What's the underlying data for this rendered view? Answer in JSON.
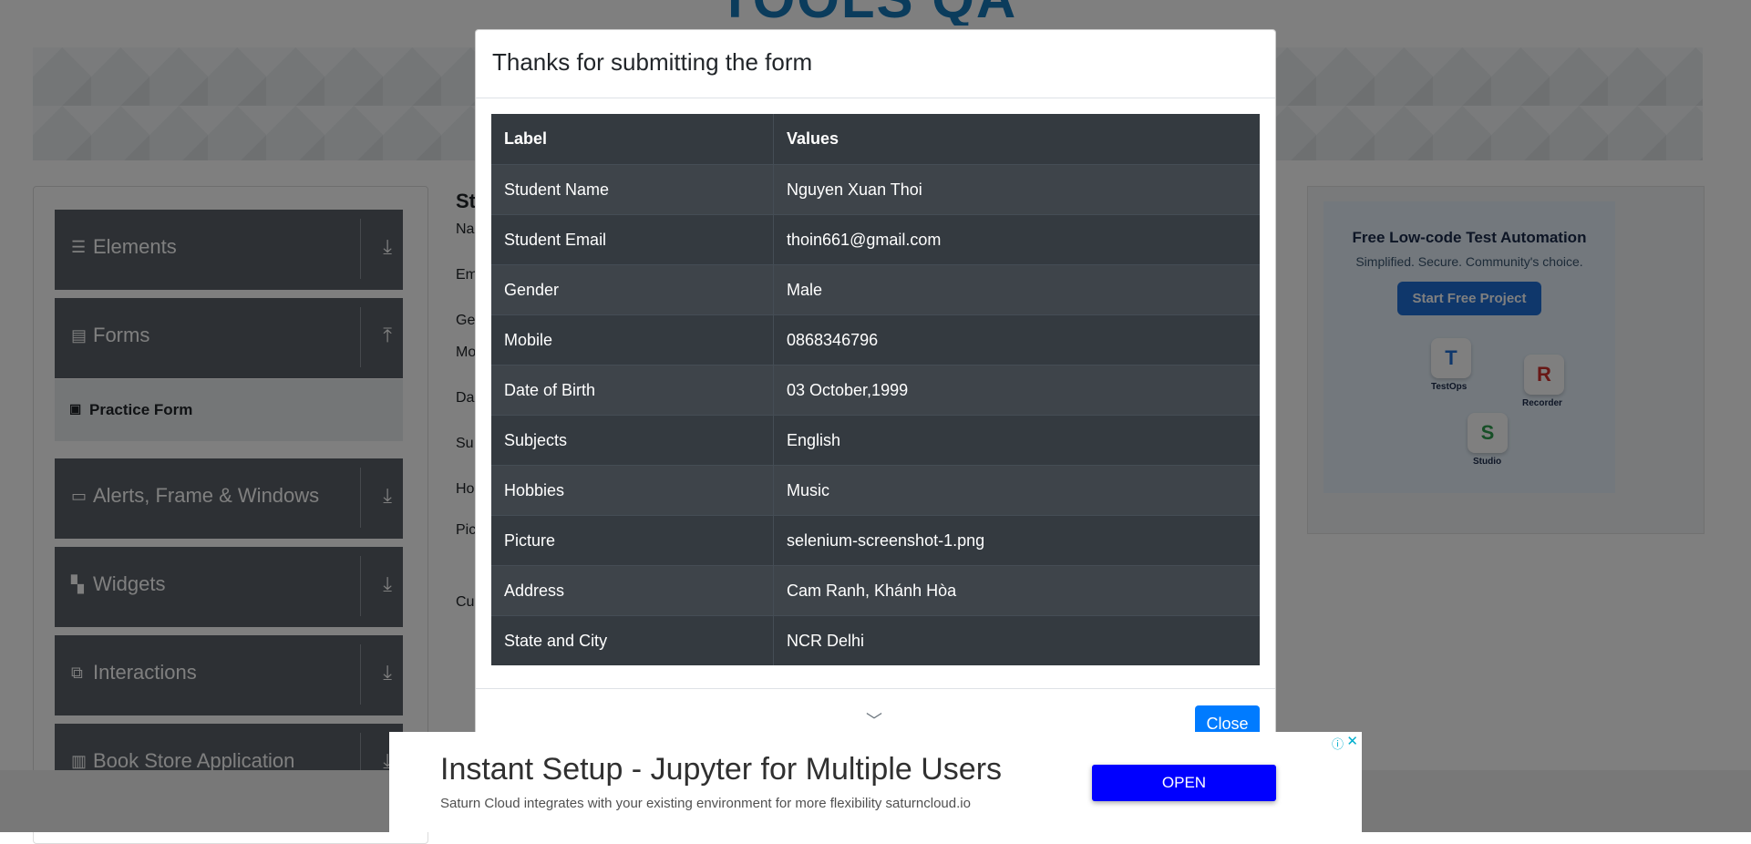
{
  "background": {
    "logo_text": "TOOLS QA",
    "sidebar": {
      "groups": [
        {
          "label": "Elements",
          "icon": "hamburger-icon",
          "arrow": "download-icon"
        },
        {
          "label": "Forms",
          "icon": "document-icon",
          "arrow": "upload-icon"
        },
        {
          "label": "Alerts, Frame & Windows",
          "icon": "window-icon",
          "arrow": "download-icon"
        },
        {
          "label": "Widgets",
          "icon": "widgets-icon",
          "arrow": "download-icon"
        },
        {
          "label": "Interactions",
          "icon": "interactions-icon",
          "arrow": "download-icon"
        },
        {
          "label": "Book Store Application",
          "icon": "books-icon",
          "arrow": "download-icon"
        }
      ],
      "active_item": "Practice Form"
    },
    "form_fragments": [
      "St",
      "Na",
      "Em",
      "Ge",
      "Mo",
      "Da",
      "Su",
      "Ho",
      "Pic",
      "Cu"
    ],
    "side_ad": {
      "title": "Free Low-code Test Automation",
      "subtitle": "Simplified. Secure. Community's choice.",
      "button": "Start Free Project",
      "captions": [
        "TestOps",
        "Recorder",
        "Studio"
      ]
    }
  },
  "modal": {
    "title": "Thanks for submitting the form",
    "table": {
      "headers": [
        "Label",
        "Values"
      ],
      "rows": [
        [
          "Student Name",
          "Nguyen Xuan Thoi"
        ],
        [
          "Student Email",
          "thoin661@gmail.com"
        ],
        [
          "Gender",
          "Male"
        ],
        [
          "Mobile",
          "0868346796"
        ],
        [
          "Date of Birth",
          "03 October,1999"
        ],
        [
          "Subjects",
          "English"
        ],
        [
          "Hobbies",
          "Music"
        ],
        [
          "Picture",
          "selenium-screenshot-1.png"
        ],
        [
          "Address",
          "Cam Ranh, Khánh Hòa"
        ],
        [
          "State and City",
          "NCR Delhi"
        ]
      ]
    },
    "close_label": "Close"
  },
  "bottom_ad": {
    "headline": "Instant Setup - Jupyter for Multiple Users",
    "description": "Saturn Cloud integrates with your existing environment for more flexibility saturncloud.io",
    "button": "OPEN"
  },
  "colors": {
    "table_dark": "#343a40",
    "table_stripe": "#3e444a",
    "primary": "#007bff",
    "ad_button": "#0000ff"
  }
}
